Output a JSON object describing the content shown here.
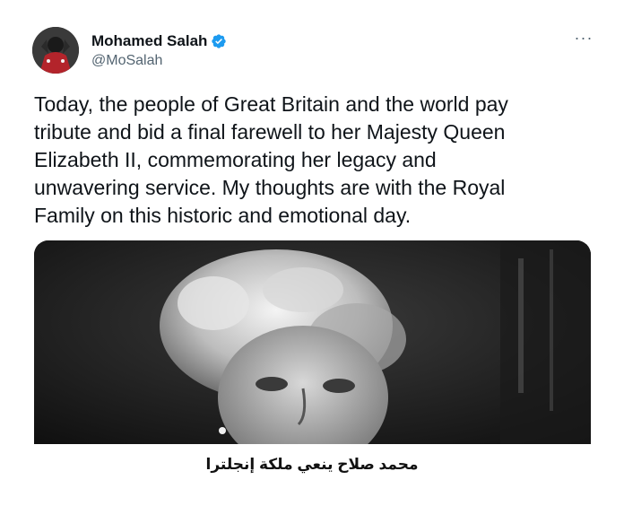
{
  "tweet": {
    "author_name": "Mohamed Salah",
    "handle": "@MoSalah",
    "verified": true,
    "more_label": "···",
    "text": "Today, the people of Great Britain and the world pay\ntribute and bid a final farewell to her Majesty Queen\nElizabeth II, commemorating her legacy and\nunwavering service. My thoughts are with the Royal\nFamily on this historic and emotional day."
  },
  "caption": "محمد صلاح ينعي ملكة إنجلترا",
  "colors": {
    "text": "#0f1419",
    "secondary": "#536471",
    "verified": "#1d9bf0"
  }
}
